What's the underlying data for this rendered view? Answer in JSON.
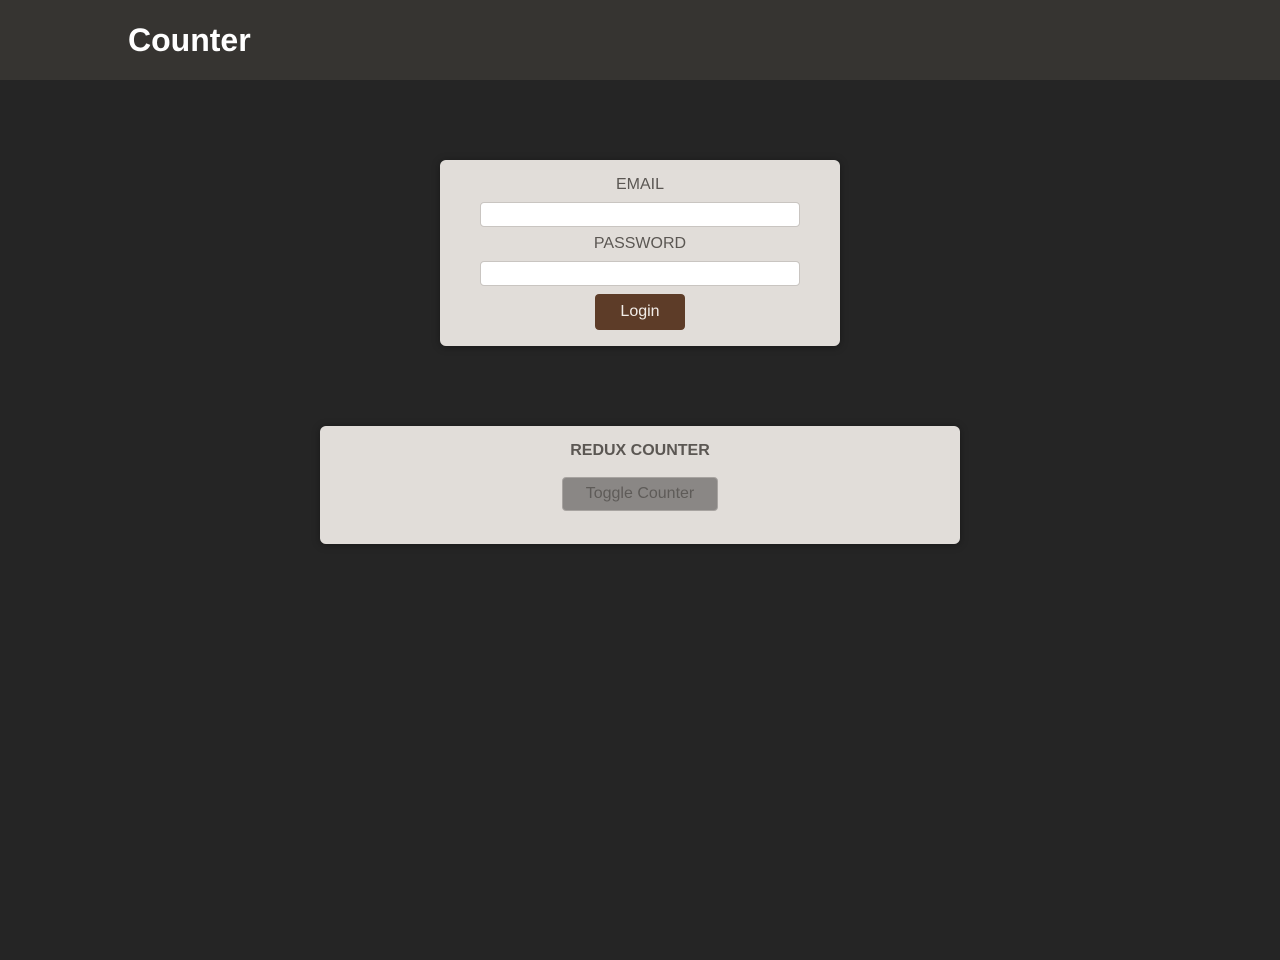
{
  "header": {
    "title": "Counter"
  },
  "auth": {
    "email_label": "EMAIL",
    "email_value": "",
    "password_label": "PASSWORD",
    "password_value": "",
    "login_label": "Login"
  },
  "counter": {
    "title": "REDUX COUNTER",
    "toggle_label": "Toggle Counter"
  },
  "colors": {
    "background": "#252525",
    "header": "#363431",
    "card": "#e1ddd9",
    "login_button": "#5d3c28",
    "toggle_button": "#8a8785"
  }
}
